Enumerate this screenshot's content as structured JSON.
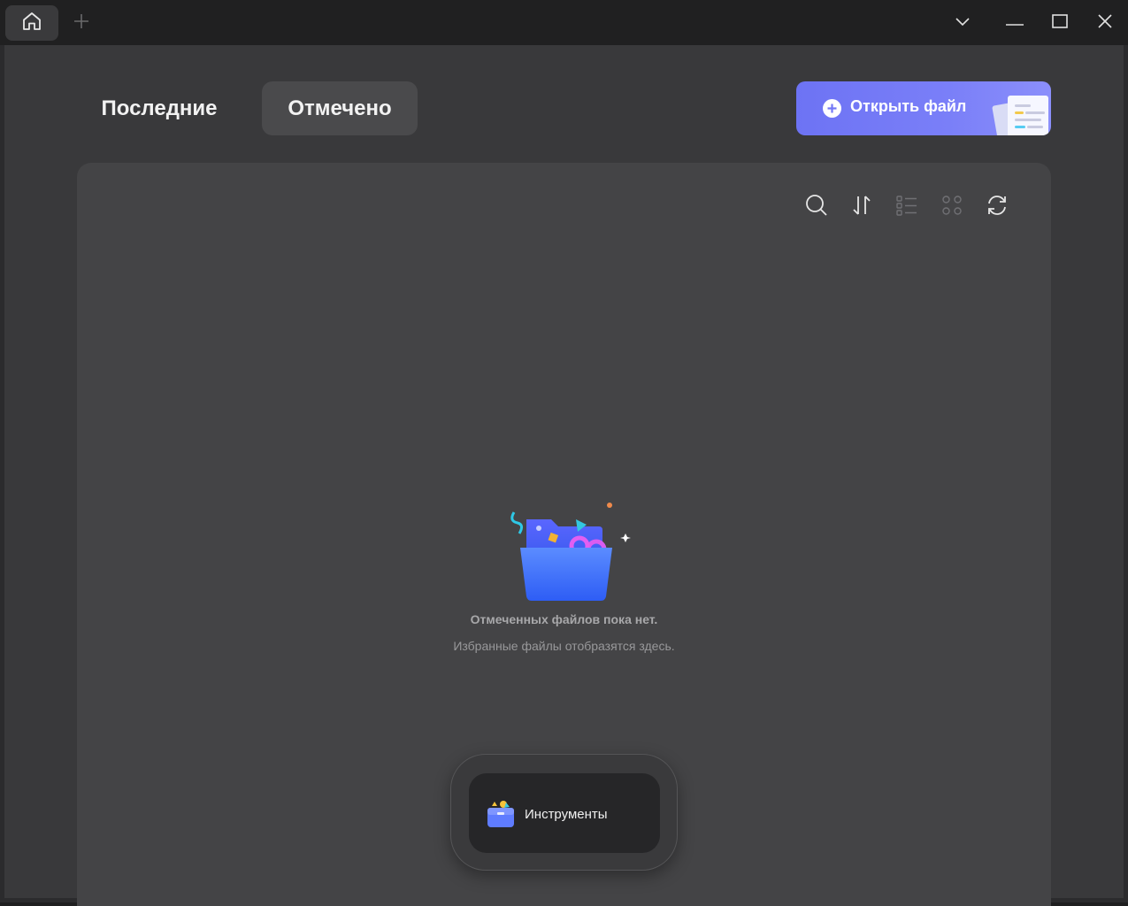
{
  "titlebar": {
    "home_tab_icon": "home-icon",
    "new_tab_icon": "plus-icon",
    "controls": [
      "chevron-down-icon",
      "minimize-icon",
      "maximize-icon",
      "close-icon"
    ]
  },
  "tabs": {
    "recent_label": "Последние",
    "marked_label": "Отмечено",
    "active": "Отмечено"
  },
  "open_file": {
    "label": "Открыть файл",
    "icon": "plus-circle-icon",
    "color": "#7378f6"
  },
  "toolbar": {
    "items": [
      "search-icon",
      "sort-icon",
      "list-view-icon",
      "grid-view-icon",
      "refresh-icon"
    ]
  },
  "empty_state": {
    "title": "Отмеченных файлов пока нет.",
    "subtitle": "Избранные файлы отобразятся здесь.",
    "illustration": "folder-illustration-icon"
  },
  "tools_panel": {
    "label": "Инструменты",
    "icon": "toolbox-icon"
  }
}
